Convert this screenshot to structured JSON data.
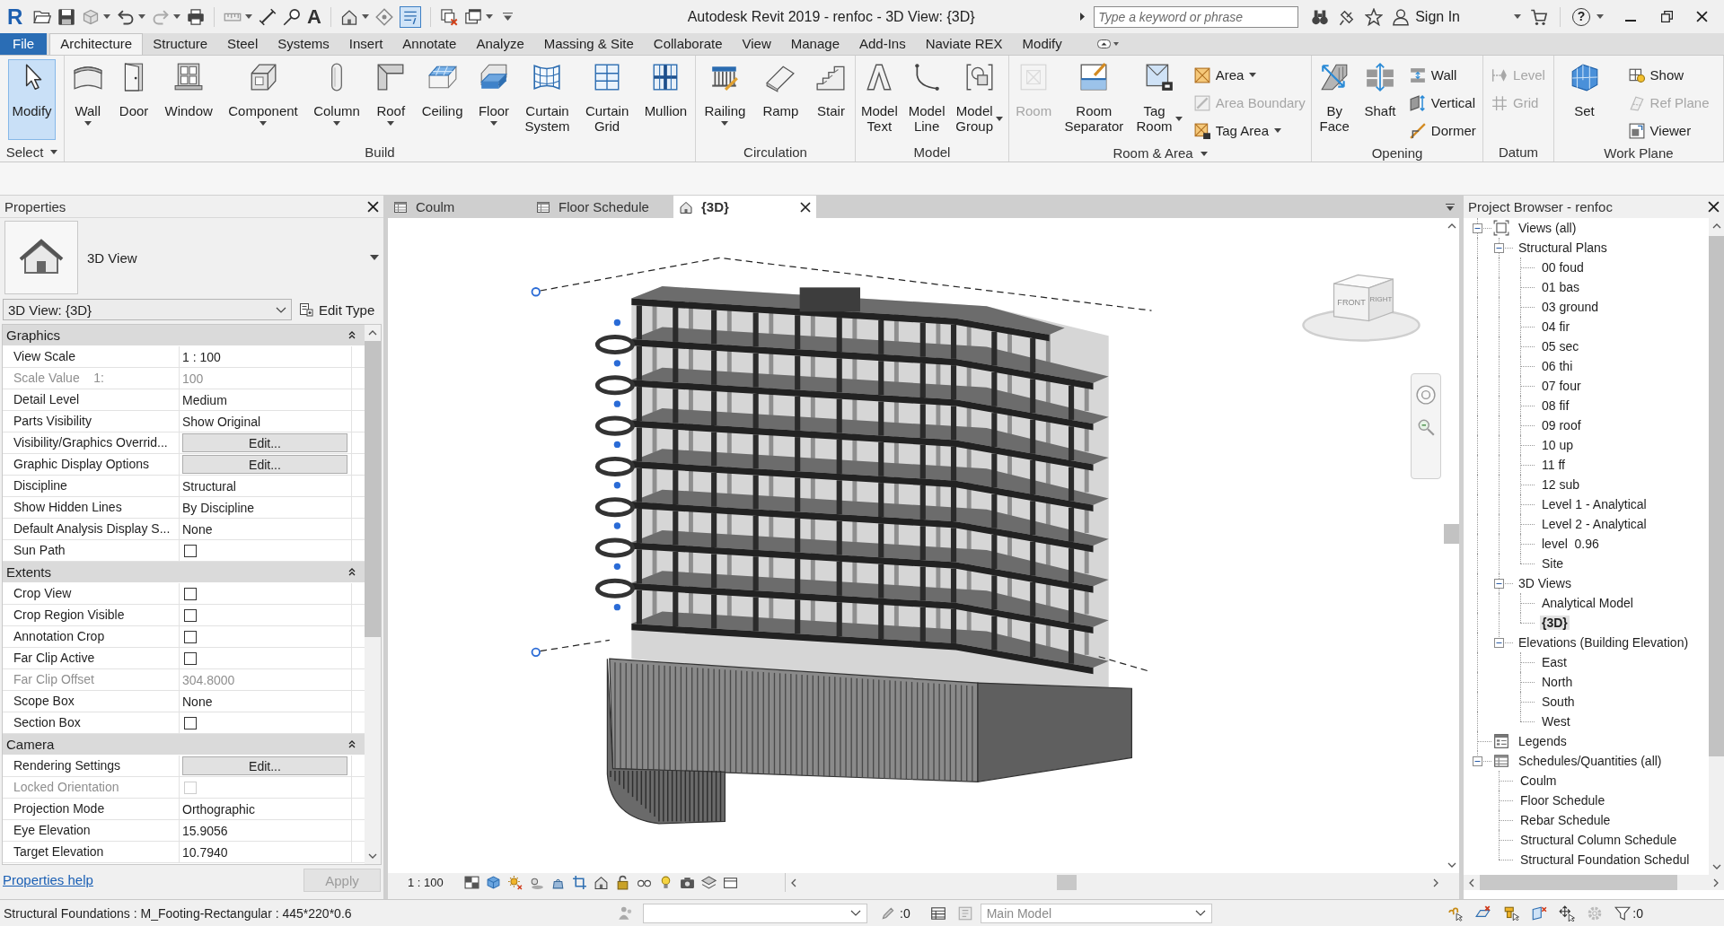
{
  "title_bar": {
    "logo": "R",
    "text_tool": "A",
    "thin_lines": {
      "on": true
    },
    "title": "Autodesk Revit 2019 - renfoc - 3D View: {3D}",
    "search": {
      "placeholder": "Type a keyword or phrase"
    },
    "sign_in": "Sign In",
    "help": "?"
  },
  "ribbon_tabs": [
    {
      "label": "File",
      "kind": "application",
      "selected": false
    },
    {
      "label": "Architecture",
      "kind": "tab",
      "selected": true
    },
    {
      "label": "Structure",
      "kind": "tab",
      "selected": false
    },
    {
      "label": "Steel",
      "kind": "tab",
      "selected": false
    },
    {
      "label": "Systems",
      "kind": "tab",
      "selected": false
    },
    {
      "label": "Insert",
      "kind": "tab",
      "selected": false
    },
    {
      "label": "Annotate",
      "kind": "tab",
      "selected": false
    },
    {
      "label": "Analyze",
      "kind": "tab",
      "selected": false
    },
    {
      "label": "Massing & Site",
      "kind": "tab",
      "selected": false
    },
    {
      "label": "Collaborate",
      "kind": "tab",
      "selected": false
    },
    {
      "label": "View",
      "kind": "tab",
      "selected": false
    },
    {
      "label": "Manage",
      "kind": "tab",
      "selected": false
    },
    {
      "label": "Add-Ins",
      "kind": "tab",
      "selected": false
    },
    {
      "label": "Naviate REX",
      "kind": "tab",
      "selected": false
    },
    {
      "label": "Modify",
      "kind": "tab",
      "selected": false
    }
  ],
  "ribbon_panels": [
    {
      "label": "Select",
      "menu": true,
      "tools": [
        {
          "label": "Modify",
          "kind": "large",
          "selected": true,
          "disabled": false
        }
      ]
    },
    {
      "label": "Build",
      "tools": [
        {
          "label": "Wall",
          "kind": "large",
          "caret_below": true,
          "selected": false,
          "disabled": false
        },
        {
          "label": "Door",
          "kind": "large",
          "selected": false,
          "disabled": false
        },
        {
          "label": "Window",
          "kind": "large",
          "selected": false,
          "disabled": false
        },
        {
          "label": "Component",
          "kind": "large",
          "caret_below": true,
          "selected": false,
          "disabled": false
        },
        {
          "label": "Column",
          "kind": "large",
          "caret_below": true,
          "selected": false,
          "disabled": false
        },
        {
          "label": "Roof",
          "kind": "large",
          "caret_below": true,
          "selected": false,
          "disabled": false
        },
        {
          "label": "Ceiling",
          "kind": "large",
          "selected": false,
          "disabled": false
        },
        {
          "label": "Floor",
          "kind": "large",
          "caret_below": true,
          "selected": false,
          "disabled": false
        },
        {
          "label": "Curtain\nSystem",
          "kind": "large",
          "selected": false,
          "disabled": false
        },
        {
          "label": "Curtain\nGrid",
          "kind": "large",
          "selected": false,
          "disabled": false
        },
        {
          "label": "Mullion",
          "kind": "large",
          "selected": false,
          "disabled": false
        }
      ]
    },
    {
      "label": "Circulation",
      "tools": [
        {
          "label": "Railing",
          "kind": "large",
          "caret_below": true,
          "selected": false,
          "disabled": false
        },
        {
          "label": "Ramp",
          "kind": "large",
          "selected": false,
          "disabled": false
        },
        {
          "label": "Stair",
          "kind": "large",
          "selected": false,
          "disabled": false
        }
      ]
    },
    {
      "label": "Model",
      "tools": [
        {
          "label": "Model\nText",
          "kind": "large",
          "selected": false,
          "disabled": false
        },
        {
          "label": "Model\nLine",
          "kind": "large",
          "selected": false,
          "disabled": false
        },
        {
          "label": "Model\nGroup",
          "kind": "large",
          "caret_right": true,
          "selected": false,
          "disabled": false
        }
      ]
    },
    {
      "label": "Room & Area",
      "menu": true,
      "tools": [
        {
          "label": "Room",
          "kind": "large",
          "selected": false,
          "disabled": true
        },
        {
          "label": "Room\nSeparator",
          "kind": "large",
          "selected": false,
          "disabled": false
        },
        {
          "label": "Tag\nRoom",
          "kind": "large",
          "caret_right": true,
          "selected": false,
          "disabled": false
        },
        {
          "label": "Area",
          "kind": "small",
          "caret_right": true,
          "selected": false,
          "disabled": false
        },
        {
          "label": "Area Boundary",
          "kind": "small",
          "selected": false,
          "disabled": true
        },
        {
          "label": "Tag Area",
          "kind": "small",
          "caret_right": true,
          "selected": false,
          "disabled": false
        }
      ]
    },
    {
      "label": "Opening",
      "tools": [
        {
          "label": "By\nFace",
          "kind": "large",
          "selected": false,
          "disabled": false
        },
        {
          "label": "Shaft",
          "kind": "large",
          "selected": false,
          "disabled": false
        },
        {
          "label": "Wall",
          "kind": "small",
          "selected": false,
          "disabled": false
        },
        {
          "label": "Vertical",
          "kind": "small",
          "selected": false,
          "disabled": false
        },
        {
          "label": "Dormer",
          "kind": "small",
          "selected": false,
          "disabled": false
        }
      ]
    },
    {
      "label": "Datum",
      "tools": [
        {
          "label": "Level",
          "kind": "small",
          "selected": false,
          "disabled": true
        },
        {
          "label": "Grid",
          "kind": "small",
          "selected": false,
          "disabled": true
        }
      ]
    },
    {
      "label": "Work Plane",
      "tools": [
        {
          "label": "Set",
          "kind": "large",
          "selected": false,
          "disabled": false
        },
        {
          "label": "Show",
          "kind": "small",
          "selected": false,
          "disabled": false
        },
        {
          "label": "Ref Plane",
          "kind": "small",
          "selected": false,
          "disabled": true
        },
        {
          "label": "Viewer",
          "kind": "small",
          "selected": false,
          "disabled": false
        }
      ]
    }
  ],
  "properties": {
    "title": "Properties",
    "type_name": "3D View",
    "instance": "3D View: {3D}",
    "edit_type": "Edit Type",
    "groups": [
      {
        "label": "Graphics",
        "expanded": true,
        "rows": [
          {
            "name": "View Scale",
            "kind": "text",
            "value": "1 : 100",
            "disabled": false
          },
          {
            "name": "Scale Value    1:",
            "kind": "text",
            "value": "100",
            "disabled": true
          },
          {
            "name": "Detail Level",
            "kind": "text",
            "value": "Medium",
            "disabled": false
          },
          {
            "name": "Parts Visibility",
            "kind": "text",
            "value": "Show Original",
            "disabled": false
          },
          {
            "name": "Visibility/Graphics Overrid...",
            "kind": "button",
            "value": "Edit...",
            "disabled": false
          },
          {
            "name": "Graphic Display Options",
            "kind": "button",
            "value": "Edit...",
            "disabled": false
          },
          {
            "name": "Discipline",
            "kind": "text",
            "value": "Structural",
            "disabled": false
          },
          {
            "name": "Show Hidden Lines",
            "kind": "text",
            "value": "By Discipline",
            "disabled": false
          },
          {
            "name": "Default Analysis Display S...",
            "kind": "text",
            "value": "None",
            "disabled": false
          },
          {
            "name": "Sun Path",
            "kind": "checkbox",
            "checked": false,
            "disabled": false
          }
        ]
      },
      {
        "label": "Extents",
        "expanded": true,
        "rows": [
          {
            "name": "Crop View",
            "kind": "checkbox",
            "checked": false,
            "disabled": false
          },
          {
            "name": "Crop Region Visible",
            "kind": "checkbox",
            "checked": false,
            "disabled": false
          },
          {
            "name": "Annotation Crop",
            "kind": "checkbox",
            "checked": false,
            "disabled": false
          },
          {
            "name": "Far Clip Active",
            "kind": "checkbox",
            "checked": false,
            "disabled": false
          },
          {
            "name": "Far Clip Offset",
            "kind": "text",
            "value": "304.8000",
            "disabled": true
          },
          {
            "name": "Scope Box",
            "kind": "text",
            "value": "None",
            "disabled": false
          },
          {
            "name": "Section Box",
            "kind": "checkbox",
            "checked": false,
            "disabled": false
          }
        ]
      },
      {
        "label": "Camera",
        "expanded": true,
        "rows": [
          {
            "name": "Rendering Settings",
            "kind": "button",
            "value": "Edit...",
            "disabled": false
          },
          {
            "name": "Locked Orientation",
            "kind": "checkbox",
            "checked": false,
            "disabled": true
          },
          {
            "name": "Projection Mode",
            "kind": "text",
            "value": "Orthographic",
            "disabled": false
          },
          {
            "name": "Eye Elevation",
            "kind": "text",
            "value": "15.9056",
            "disabled": false
          },
          {
            "name": "Target Elevation",
            "kind": "text",
            "value": "10.7940",
            "disabled": false
          }
        ]
      }
    ],
    "help_link": "Properties help",
    "apply": {
      "label": "Apply",
      "disabled": true
    }
  },
  "view_tabs": [
    {
      "label": "Coulm",
      "kind": "schedule",
      "selected": false
    },
    {
      "label": "Floor Schedule",
      "kind": "schedule",
      "selected": false
    },
    {
      "label": "{3D}",
      "kind": "model",
      "selected": true
    }
  ],
  "view_cube": {
    "faces": [
      "FRONT",
      "RIGHT"
    ]
  },
  "view_controls": {
    "scale": "1 : 100"
  },
  "project_browser": {
    "title": "Project Browser - renfoc",
    "tree": [
      {
        "label": "Views (all)",
        "expanded": true,
        "selected": false,
        "children": [
          {
            "label": "Structural Plans",
            "expanded": true,
            "selected": false,
            "children": [
              {
                "label": "00 foud",
                "selected": false
              },
              {
                "label": "01 bas",
                "selected": false
              },
              {
                "label": "03 ground",
                "selected": false
              },
              {
                "label": "04 fir",
                "selected": false
              },
              {
                "label": "05 sec",
                "selected": false
              },
              {
                "label": "06 thi",
                "selected": false
              },
              {
                "label": "07 four",
                "selected": false
              },
              {
                "label": "08 fif",
                "selected": false
              },
              {
                "label": "09 roof",
                "selected": false
              },
              {
                "label": "10 up",
                "selected": false
              },
              {
                "label": "11 ff",
                "selected": false
              },
              {
                "label": "12 sub",
                "selected": false
              },
              {
                "label": "Level 1 - Analytical",
                "selected": false
              },
              {
                "label": "Level 2 - Analytical",
                "selected": false
              },
              {
                "label": "level  0.96",
                "selected": false
              },
              {
                "label": "Site",
                "selected": false
              }
            ]
          },
          {
            "label": "3D Views",
            "expanded": true,
            "selected": false,
            "children": [
              {
                "label": "Analytical Model",
                "selected": false
              },
              {
                "label": "{3D}",
                "selected": true
              }
            ]
          },
          {
            "label": "Elevations (Building Elevation)",
            "expanded": true,
            "selected": false,
            "children": [
              {
                "label": "East",
                "selected": false
              },
              {
                "label": "North",
                "selected": false
              },
              {
                "label": "South",
                "selected": false
              },
              {
                "label": "West",
                "selected": false
              }
            ]
          }
        ]
      },
      {
        "label": "Legends",
        "selected": false
      },
      {
        "label": "Schedules/Quantities (all)",
        "expanded": true,
        "selected": false,
        "children": [
          {
            "label": "Coulm",
            "selected": false
          },
          {
            "label": "Floor Schedule",
            "selected": false
          },
          {
            "label": "Rebar Schedule",
            "selected": false
          },
          {
            "label": "Structural Column Schedule",
            "selected": false
          },
          {
            "label": "Structural Foundation Schedul",
            "selected": false
          }
        ]
      }
    ]
  },
  "status_bar": {
    "message": "Structural Foundations : M_Footing-Rectangular : 445*220*0.6",
    "editable_count": ":0",
    "design_option": {
      "value": "Main Model",
      "disabled": true
    },
    "filter_count": ":0"
  }
}
